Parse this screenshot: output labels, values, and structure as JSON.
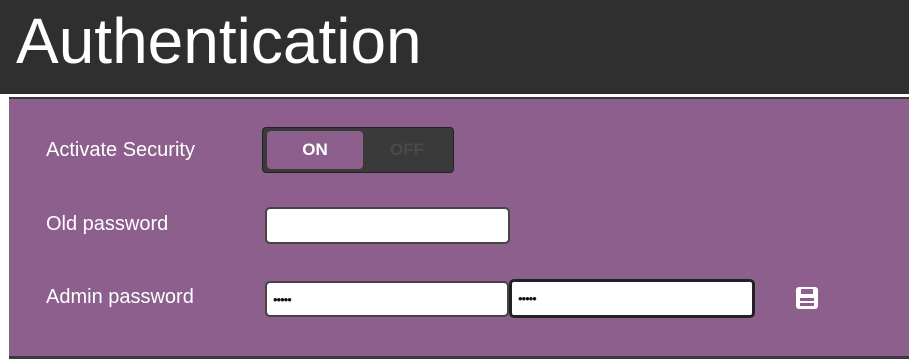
{
  "header": {
    "title": "Authentication"
  },
  "form": {
    "activate_security": {
      "label": "Activate Security",
      "on_label": "ON",
      "off_label": "OFF",
      "state": "ON"
    },
    "old_password": {
      "label": "Old password",
      "value": ""
    },
    "admin_password": {
      "label": "Admin password",
      "value": "•••••",
      "confirm_value": "•••••"
    }
  },
  "icons": {
    "save": "floppy-disk-icon"
  },
  "colors": {
    "header_bg": "#2f2f2f",
    "panel_bg": "#8c5f8c",
    "toggle_on_bg": "#8c5f8c",
    "toggle_track": "#3a3a3a"
  }
}
